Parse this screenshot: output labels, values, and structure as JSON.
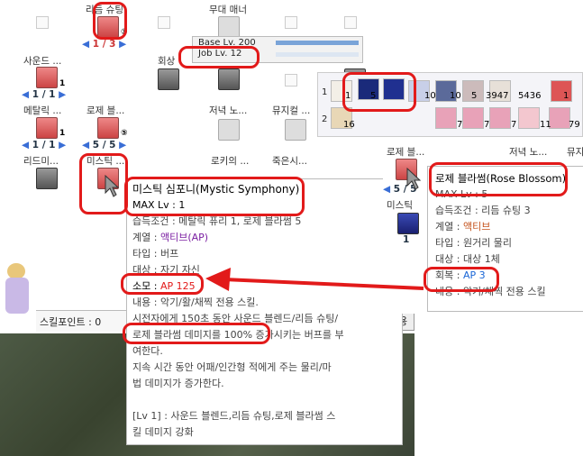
{
  "skill_tree": {
    "rhythm_shooting": {
      "label": "리듬 슈팅",
      "level_text": "1 / 3",
      "badge": "③"
    },
    "stage_manner": {
      "label": "무대 매너"
    },
    "sound_blend": {
      "label": "사운드 ...",
      "level_text": "1 / 1",
      "badge": "1"
    },
    "recovery": {
      "label": "회상"
    },
    "metallic_fury": {
      "label": "메탈릭 ...",
      "level_text": "1 / 1",
      "badge": "1"
    },
    "rose_blossom": {
      "label": "로제 블...",
      "level_text": "5 / 5",
      "badge": "⑤"
    },
    "evening_no": {
      "label": "저녁 노..."
    },
    "musical": {
      "label": "뮤지컬 ..."
    },
    "rhythm_mi": {
      "label": "리드미..."
    },
    "mystic": {
      "label": "미스틱 ..."
    },
    "lokis": {
      "label": "로키의 ..."
    },
    "dead": {
      "label": "죽은시..."
    },
    "skill_points_label": "스킬포인트 : 0",
    "apply_label": "적용"
  },
  "status_bars": {
    "base_level": "Base Lv. 200",
    "job_level": "Job Lv. 12"
  },
  "hotbar": {
    "rows": [
      "1",
      "2"
    ],
    "row1_counts": [
      "1",
      "5",
      "10",
      "10",
      "5",
      "3947",
      "5436",
      "1"
    ],
    "row2_counts": [
      "16",
      "7",
      "7",
      "7",
      "11",
      "79"
    ]
  },
  "tooltip_mystic": {
    "title": "미스틱 심포니(Mystic Symphony)",
    "max": "MAX Lv : 1",
    "req": "습득조건 : 메탈릭 퓨리 1, 로제 블라썸 5",
    "family_key": "계열 : ",
    "family_val": "액티브(AP)",
    "type_key": "타입 : ",
    "type_val": "버프",
    "target_key": "대상 : ",
    "target_val": "자기 자신",
    "cost_key": "소모 : ",
    "cost_val": "AP 125",
    "content": "내용 : 악기/활/채찍 전용 스킬.",
    "d1": "시전자에게 150초 동안 사운드 블렌드/리듬 슈팅/",
    "d2": "로제 블라썸 데미지를 100% 증가시키는 버프를 부",
    "d3": "여한다.",
    "d4": "지속 시간 동안 어패/인간형 적에게 주는 물리/마",
    "d5": "법 데미지가 증가한다.",
    "lv1": "[Lv 1] : 사운드 블렌드,리듬 슈팅,로제 블라썸 스",
    "lv2": "킬 데미지 강화"
  },
  "tooltip_rose": {
    "header_label": "로제 블...",
    "header_label2": "저녁 노...",
    "header_label3": "뮤지",
    "level_text": "5 / 5",
    "mystic_label": "미스틱",
    "small_count": "1",
    "title": "로제 블라썸(Rose Blossom)",
    "max": "MAX Lv : 5",
    "req": "습득조건 : 리듬 슈팅 3",
    "family_key": "계열 : ",
    "family_val": "액티브",
    "type_key": "타입 : ",
    "type_val": "원거리 물리",
    "target_key": "대상 : ",
    "target_val": "대상 1체",
    "recover_key": "회복 : ",
    "recover_val": "AP 3",
    "content": "내용 : 악기/채찍 전용 스킬"
  }
}
